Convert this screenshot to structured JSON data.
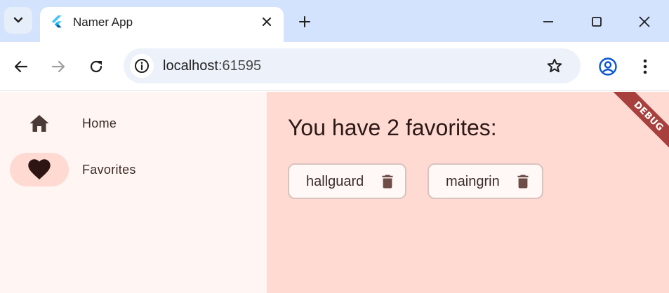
{
  "browser": {
    "tab": {
      "title": "Namer App",
      "favicon": "flutter-logo-icon",
      "close_icon": "close-icon"
    },
    "tab_search_icon": "chevron-down-icon",
    "new_tab_icon": "plus-icon",
    "window_controls": [
      "minimize-icon",
      "maximize-icon",
      "close-window-icon"
    ],
    "nav": {
      "back": "arrow-left-icon",
      "forward": "arrow-right-icon",
      "reload": "reload-icon"
    },
    "omnibox": {
      "host": "localhost",
      "port": ":61595",
      "site_info_icon": "info-icon",
      "bookmark_icon": "star-icon"
    },
    "profile_icon": "account-circle-icon",
    "menu_icon": "more-vert-icon"
  },
  "app": {
    "nav_rail": {
      "destinations": [
        {
          "label": "Home",
          "icon": "home-icon",
          "selected": false
        },
        {
          "label": "Favorites",
          "icon": "favorite-icon",
          "selected": true
        }
      ]
    },
    "favorites_page": {
      "heading": "You have 2 favorites:",
      "items": [
        {
          "label": "hallguard",
          "delete_icon": "delete-icon"
        },
        {
          "label": "maingrin",
          "delete_icon": "delete-icon"
        }
      ]
    },
    "debug_banner": "DEBUG"
  },
  "colors": {
    "tabstrip": "#d3e3fd",
    "omnibox": "#edf2fa",
    "rail_background": "#fff5f3",
    "page_background": "#ffdad3",
    "selected_indicator": "#ffdad2",
    "debug_banner": "#a8413d",
    "flutter_blue": "#47c5fb",
    "profile_blue": "#0b57d0"
  }
}
